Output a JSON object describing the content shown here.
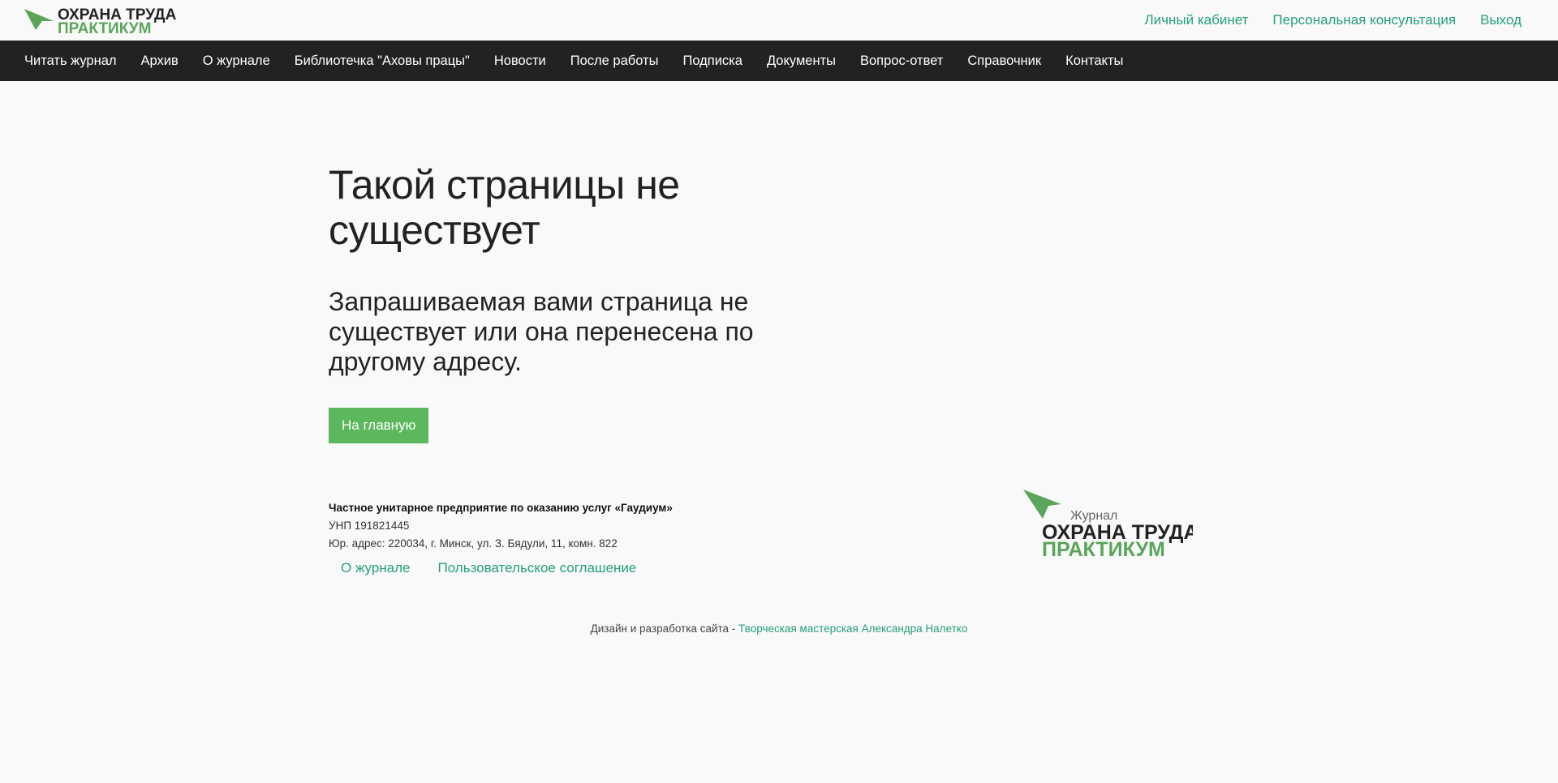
{
  "header": {
    "logo": {
      "line1": "ОХРАНА ТРУДА",
      "line2": "ПРАКТИКУМ"
    },
    "links": [
      "Личный кабинет",
      "Персональная консультация",
      "Выход"
    ]
  },
  "nav": {
    "items": [
      "Читать журнал",
      "Архив",
      "О журнале",
      "Библиотечка \"Аховы працы\"",
      "Новости",
      "После работы",
      "Подписка",
      "Документы",
      "Вопрос-ответ",
      "Справочник",
      "Контакты"
    ]
  },
  "main": {
    "title": "Такой страницы не существует",
    "message": "Запрашиваемая вами страница не существует или она перенесена по другому адресу.",
    "home_button": "На главную"
  },
  "footer": {
    "company": "Частное унитарное предприятие по оказанию услуг  «Гаудиум»",
    "unp": "УНП 191821445",
    "address": "Юр. адрес: 220034, г. Минск, ул. З. Бядули, 11, комн. 822",
    "links": [
      "О журнале",
      "Пользовательское соглашение"
    ],
    "logo": {
      "small": "Журнал",
      "line1": "ОХРАНА ТРУДА",
      "line2": "ПРАКТИКУМ"
    },
    "credit_prefix": "Дизайн и разработка сайта - ",
    "credit_link": "Творческая мастерская Александра Налетко"
  },
  "colors": {
    "accent_green": "#5cb85c",
    "link_teal": "#24a07a",
    "navbar_bg": "#222222"
  }
}
